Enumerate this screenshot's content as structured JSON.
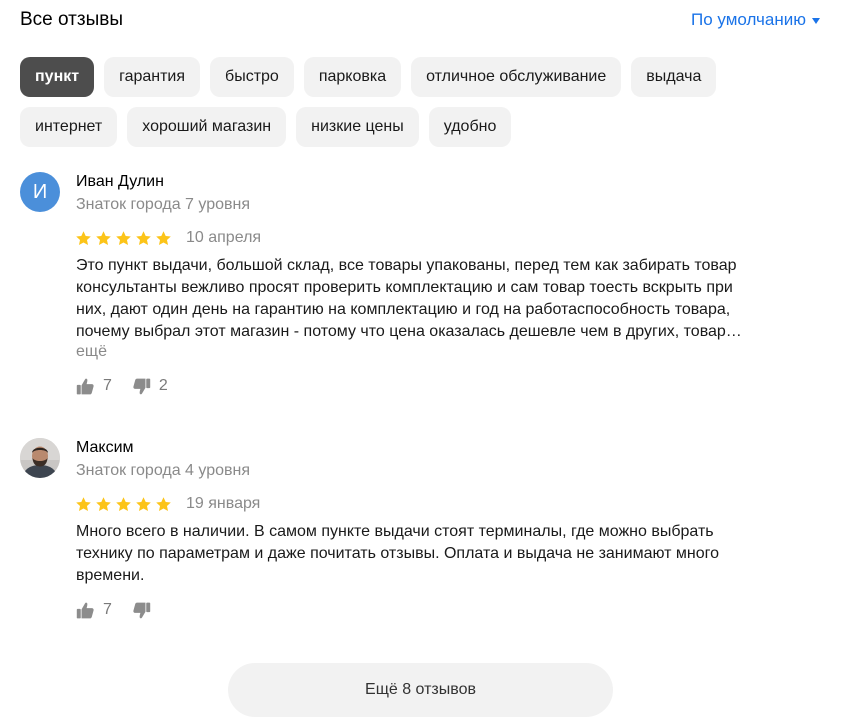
{
  "header": {
    "title": "Все отзывы",
    "sort_label": "По умолчанию"
  },
  "tags": [
    [
      {
        "label": "пункт",
        "active": true
      },
      {
        "label": "гарантия"
      },
      {
        "label": "быстро"
      },
      {
        "label": "парковка"
      },
      {
        "label": "отличное обслуживание"
      },
      {
        "label": "выдача"
      }
    ],
    [
      {
        "label": "интернет"
      },
      {
        "label": "хороший магазин"
      },
      {
        "label": "низкие цены"
      },
      {
        "label": "удобно"
      }
    ]
  ],
  "reviews": [
    {
      "avatar_letter": "И",
      "author": "Иван Дулин",
      "level": "Знаток города 7 уровня",
      "rating": 5,
      "date": "10 апреля",
      "text_lines": [
        "Это пункт выдачи, большой склад, все товары упакованы, перед тем как забирать товар",
        "консультанты вежливо просят проверить комплектацию и сам товар тоесть вскрыть при",
        "них, дают один день на гарантию на комплектацию и год на работаспособность товара,",
        "почему выбрал этот магазин - потому что цена оказалась дешевле чем в других, товар…"
      ],
      "more_label": "ещё",
      "likes": "7",
      "dislikes": "2"
    },
    {
      "author": "Максим",
      "level": "Знаток города 4 уровня",
      "rating": 5,
      "date": "19 января",
      "text_lines": [
        "Много всего в наличии. В самом пункте выдачи стоят терминалы, где можно выбрать",
        "технику по параметрам и даже почитать отзывы. Оплата и выдача не занимают много",
        "времени."
      ],
      "likes": "7"
    }
  ],
  "load_more_label": "Ещё 8 отзывов",
  "colors": {
    "accent": "#1a73e8",
    "star": "#fcc419",
    "tag_bg": "#f2f2f2",
    "tag_active_bg": "#4d4d4d",
    "avatar_bg": "#4b8fda",
    "muted_text": "#8a8a8a"
  },
  "icons": {
    "sort": "chevron-down-icon",
    "rating": "star-icon",
    "like": "thumbs-up-icon",
    "dislike": "thumbs-down-icon"
  }
}
